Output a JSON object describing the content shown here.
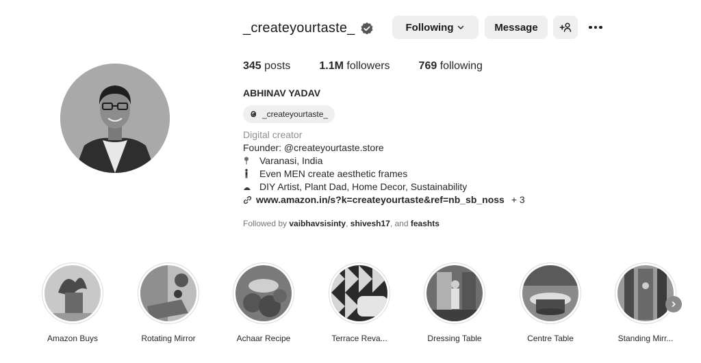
{
  "profile": {
    "username": "_createyourtaste_",
    "verified": true,
    "buttons": {
      "following": "Following",
      "message": "Message"
    },
    "stats": {
      "posts_count": "345",
      "posts_label": " posts",
      "followers_count": "1.1M",
      "followers_label": " followers",
      "following_count": "769",
      "following_label": " following"
    },
    "full_name": "ABHINAV YADAV",
    "threads_handle": "_createyourtaste_",
    "category": "Digital creator",
    "bio": {
      "founder": "Founder: @createyourtaste.store",
      "location": "Varanasi, India",
      "tagline": "Even MEN create aesthetic frames",
      "interests": "DIY Artist, Plant Dad, Home Decor, Sustainability"
    },
    "link": {
      "url": "www.amazon.in/s?k=createyourtaste&ref=nb_sb_noss",
      "more": "+ 3"
    },
    "followed_by": {
      "prefix": "Followed by ",
      "user1": "vaibhavsisinty",
      "sep": ", ",
      "user2": "shivesh17",
      "and": ", and ",
      "user3": "feashts"
    }
  },
  "highlights": [
    {
      "label": "Amazon Buys"
    },
    {
      "label": "Rotating Mirror"
    },
    {
      "label": "Achaar Recipe"
    },
    {
      "label": "Terrace Reva..."
    },
    {
      "label": "Dressing Table"
    },
    {
      "label": "Centre Table"
    },
    {
      "label": "Standing Mirr..."
    }
  ],
  "icons": {
    "verified": "verified-badge-icon",
    "dropdown": "chevron-down-icon",
    "suggest": "add-person-icon",
    "more": "more-options-icon",
    "threads": "threads-icon",
    "location": "pin-icon",
    "person": "person-icon",
    "link": "link-icon",
    "next": "chevron-right-icon"
  }
}
